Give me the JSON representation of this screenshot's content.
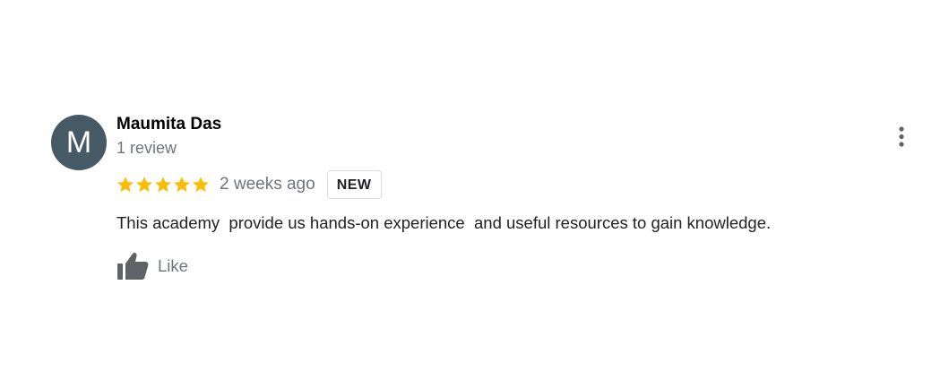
{
  "review": {
    "avatar_letter": "M",
    "avatar_color": "#455a64",
    "reviewer_name": "Maumita Das",
    "review_count": "1 review",
    "rating": 5,
    "max_rating": 5,
    "star_color": "#fbbc04",
    "time_ago": "2 weeks ago",
    "badge": "NEW",
    "text": "This academy  provide us hands-on experience  and useful resources to gain knowledge.",
    "like_label": "Like",
    "menu_icon": "more-vert-icon",
    "like_icon": "thumb-up-icon"
  }
}
